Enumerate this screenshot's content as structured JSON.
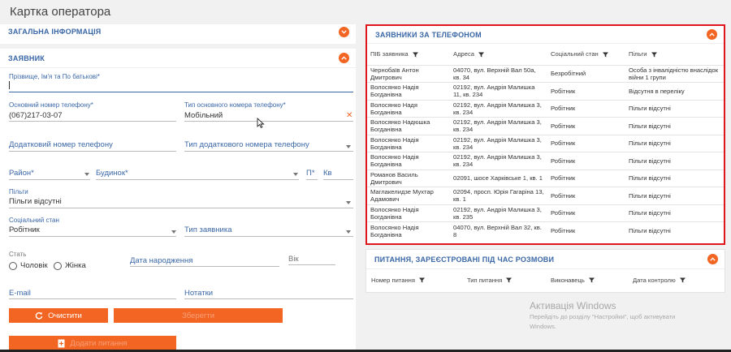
{
  "page": {
    "title": "Картка оператора"
  },
  "general_section": {
    "title": "ЗАГАЛЬНА ІНФОРМАЦІЯ"
  },
  "applicant_section": {
    "title": "ЗАЯВНИК",
    "full_name": {
      "label": "Прізвище, Ім'я та По батькові*",
      "value": ""
    },
    "main_phone": {
      "label": "Основний номер телефону*",
      "value": "(067)217-03-07"
    },
    "main_phone_type": {
      "label": "Тип основного номера телефону*",
      "value": "Мобільний"
    },
    "extra_phone": {
      "placeholder": "Додатковий номер телефону"
    },
    "extra_phone_type": {
      "placeholder": "Тип додаткового номера телефону"
    },
    "district": {
      "placeholder": "Район*"
    },
    "building": {
      "placeholder": "Будинок*"
    },
    "entrance": {
      "placeholder": "П*"
    },
    "apartment": {
      "placeholder": "Кв"
    },
    "benefits": {
      "label": "Пільги",
      "value": "Пільги відсутні"
    },
    "social_status": {
      "label": "Соціальний стан",
      "value": "Робітник"
    },
    "applicant_type": {
      "placeholder": "Тип заявника"
    },
    "gender": {
      "label": "Стать",
      "male": "Чоловік",
      "female": "Жінка"
    },
    "birth_date": {
      "placeholder": "Дата народження"
    },
    "age": {
      "placeholder": "Вік"
    },
    "email": {
      "placeholder": "E-mail"
    },
    "notes": {
      "placeholder": "Нотатки"
    },
    "clear_button": "Очистити",
    "save_button": "Зберегти",
    "add_question_button": "Додати питання"
  },
  "applicants_by_phone": {
    "title": "ЗАЯВНИКИ ЗА ТЕЛЕФОНОМ",
    "columns": [
      "ПІБ заявника",
      "Адреса",
      "Соціальний стан",
      "Пільги"
    ],
    "rows": [
      [
        "Чернобаїв Антон Дмитрович",
        "04070, вул. Верхній Вал 50а, кв. 34",
        "Безробітний",
        "Особа з інвалідністю внаслідок війни 1 групи"
      ],
      [
        "Волосянко Надія Богданівна",
        "02192, вул. Андрія Малишка 11, кв. 234",
        "Робітник",
        "Відсутня в переліку"
      ],
      [
        "Волосянко Надя Богданівна",
        "02192, вул. Андрія Малишка 3, кв. 234",
        "Робітник",
        "Пільги відсутні"
      ],
      [
        "Волосянко Надюшка Богданівна",
        "02192, вул. Андрія Малишка 3, кв. 234",
        "Робітник",
        "Пільги відсутні"
      ],
      [
        "Волосянко Надія Богданівна",
        "02192, вул. Андрія Малишка 3, кв. 234",
        "Робітник",
        "Пільги відсутні"
      ],
      [
        "Волосянко Надія Богданівна",
        "02192, вул. Андрія Малишка 3, кв. 234",
        "Робітник",
        "Пільги відсутні"
      ],
      [
        "Романов Василь Дмитрович",
        "02091, шосе Харківське 1, кв. 1",
        "Робітник",
        "Пільги відсутні"
      ],
      [
        "Маглакелидзе Мухтар Адамович",
        "02094, просп. Юрія Гагаріна 13, кв. 1",
        "Робітник",
        "Пільги відсутні"
      ],
      [
        "Волосянко Надія Богданівна",
        "02192, вул. Андрія Малишка 3, кв. 235",
        "Робітник",
        "Пільги відсутні"
      ],
      [
        "Волосянко Надія Богданівна",
        "04070, вул. Верхній Вал 32, кв. 8",
        "Робітник",
        "Пільги відсутні"
      ]
    ]
  },
  "questions_section": {
    "title": "ПИТАННЯ, ЗАРЕЄСТРОВАНІ ПІД ЧАС РОЗМОВИ",
    "columns": [
      "Номер питання",
      "Тип питання",
      "Виконавець",
      "Дата контролю"
    ]
  },
  "watermark": {
    "title": "Активація Windows",
    "line1": "Перейдіть до розділу \"Настройки\", щоб активувати",
    "line2": "Windows."
  },
  "colors": {
    "accent": "#f26522",
    "link": "#3a67a6",
    "highlight_border": "#e0161d"
  }
}
